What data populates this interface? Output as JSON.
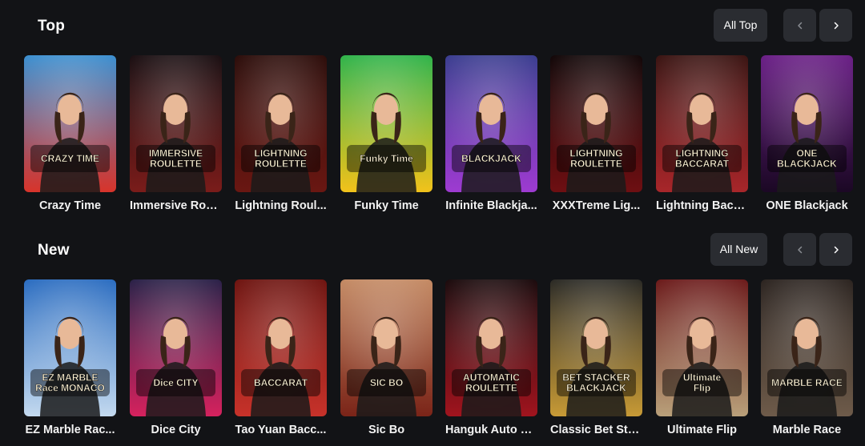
{
  "sections": [
    {
      "title": "Top",
      "all_label": "All Top",
      "games": [
        {
          "title": "Crazy Time",
          "logo": "CRAZY TIME",
          "bg1": "#3b8fd0",
          "bg2": "#d8342b",
          "icon": "wheel"
        },
        {
          "title": "Immersive Rou...",
          "logo": "IMMERSIVE ROULETTE",
          "bg1": "#1a0f12",
          "bg2": "#7a1c1a",
          "icon": "roulette"
        },
        {
          "title": "Lightning Roul...",
          "logo": "LIGHTNING ROULETTE",
          "bg1": "#2c0d0a",
          "bg2": "#6a1712",
          "icon": "lightning"
        },
        {
          "title": "Funky Time",
          "logo": "Funky Time",
          "bg1": "#2fb34a",
          "bg2": "#f2c21b",
          "icon": "funky"
        },
        {
          "title": "Infinite Blackja...",
          "logo": "BLACKJACK",
          "bg1": "#3a3d8f",
          "bg2": "#9e3bd1",
          "icon": "infinity"
        },
        {
          "title": "XXXTreme Lig...",
          "logo": "LIGHTNING ROULETTE",
          "bg1": "#120708",
          "bg2": "#6e0f12",
          "icon": "xxx"
        },
        {
          "title": "Lightning Bacc...",
          "logo": "LIGHTNING BACCARAT",
          "bg1": "#3a1412",
          "bg2": "#a8262a",
          "icon": "baccarat"
        },
        {
          "title": "ONE Blackjack",
          "logo": "ONE BLACKJACK",
          "bg1": "#6a1f86",
          "bg2": "#1b0824",
          "icon": "one"
        }
      ]
    },
    {
      "title": "New",
      "all_label": "All New",
      "games": [
        {
          "title": "EZ Marble Rac...",
          "logo": "EZ MARBLE Race MONACO",
          "bg1": "#2a6cc0",
          "bg2": "#c3d9ef",
          "icon": "marble"
        },
        {
          "title": "Dice City",
          "logo": "Dice CITY",
          "bg1": "#2a2148",
          "bg2": "#d5225e",
          "icon": "dice"
        },
        {
          "title": "Tao Yuan Bacc...",
          "logo": "BACCARAT",
          "bg1": "#6e1410",
          "bg2": "#c7322a",
          "icon": "tao"
        },
        {
          "title": "Sic Bo",
          "logo": "SIC BO",
          "bg1": "#c48a64",
          "bg2": "#7a2418",
          "icon": "sicbo"
        },
        {
          "title": "Hanguk Auto R...",
          "logo": "AUTOMATIC ROULETTE",
          "bg1": "#1b0b0d",
          "bg2": "#a0141e",
          "icon": "auto"
        },
        {
          "title": "Classic Bet Sta...",
          "logo": "BET STACKER BLACKJACK",
          "bg1": "#2b2a25",
          "bg2": "#c79a36",
          "icon": "stacker"
        },
        {
          "title": "Ultimate Flip",
          "logo": "Ultimate Flip",
          "bg1": "#6b1a1a",
          "bg2": "#b9a07a",
          "icon": "flip"
        },
        {
          "title": "Marble Race",
          "logo": "MARBLE RACE",
          "bg1": "#2c2420",
          "bg2": "#6e5b4a",
          "icon": "race"
        }
      ]
    }
  ]
}
